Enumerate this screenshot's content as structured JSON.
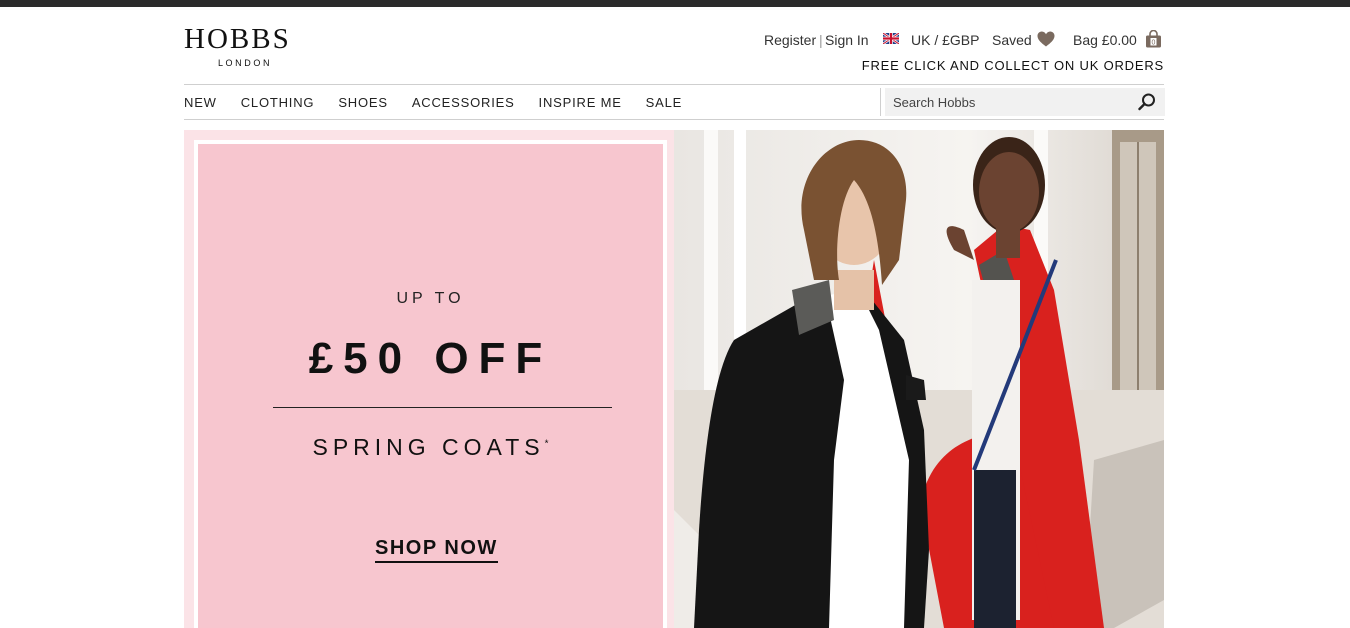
{
  "brand": {
    "name": "HOBBS",
    "tagline": "LONDON"
  },
  "utility": {
    "register": "Register",
    "separator": "|",
    "sign_in": "Sign In",
    "locale": "UK / £GBP",
    "saved": "Saved",
    "bag": "Bag £0.00",
    "bag_count": "0",
    "promo": "FREE CLICK AND COLLECT ON UK ORDERS"
  },
  "nav": {
    "items": [
      {
        "label": "NEW"
      },
      {
        "label": "CLOTHING"
      },
      {
        "label": "SHOES"
      },
      {
        "label": "ACCESSORIES"
      },
      {
        "label": "INSPIRE ME"
      },
      {
        "label": "SALE"
      }
    ]
  },
  "search": {
    "placeholder": "Search Hobbs"
  },
  "hero": {
    "eyebrow": "UP TO",
    "headline": "£50 OFF",
    "subhead": "SPRING COATS",
    "asterisk": "*",
    "cta": "SHOP NOW"
  },
  "colors": {
    "pink_panel": "#f7c6cf",
    "pink_frame": "#fbe3e7",
    "red_coat": "#d9211e",
    "heart": "#7a6a5f"
  }
}
